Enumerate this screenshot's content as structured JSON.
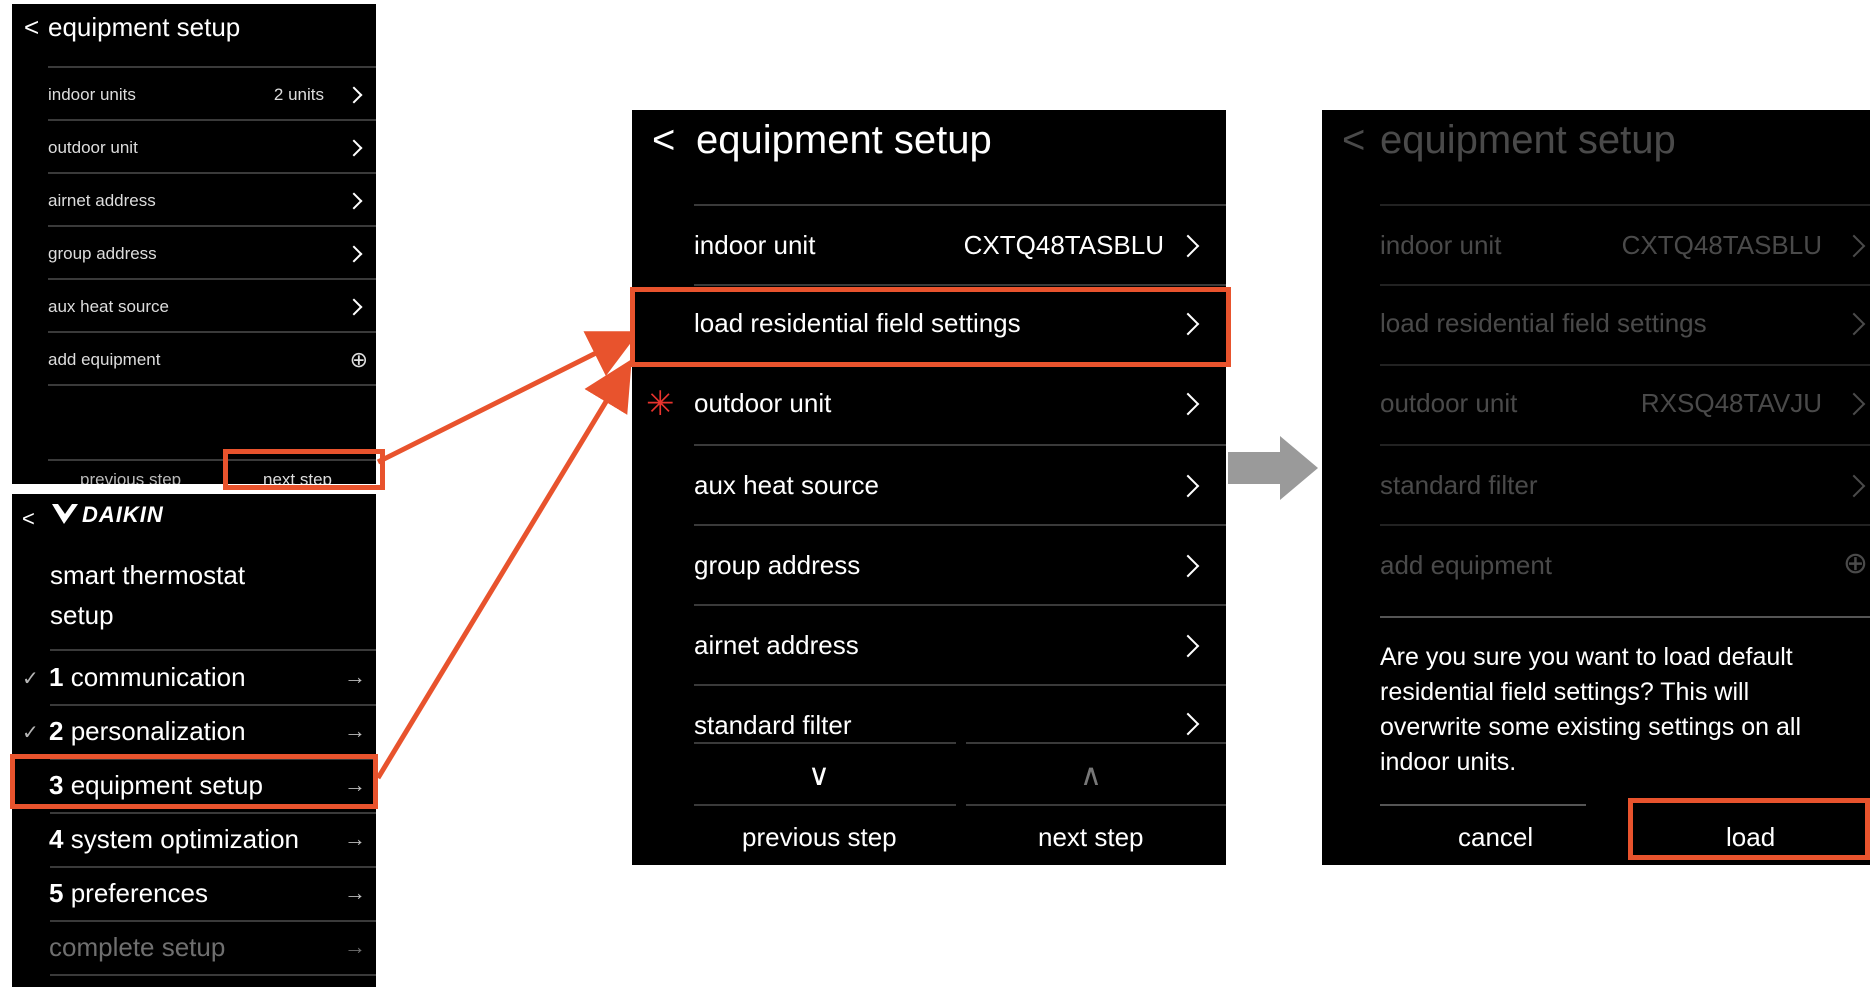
{
  "panel_a": {
    "title": "equipment setup",
    "back_glyph": "<",
    "items": [
      {
        "label": "indoor units",
        "value": "2 units"
      },
      {
        "label": "outdoor unit",
        "value": ""
      },
      {
        "label": "airnet address",
        "value": ""
      },
      {
        "label": "group address",
        "value": ""
      },
      {
        "label": "aux heat source",
        "value": ""
      },
      {
        "label": "add equipment",
        "value": ""
      }
    ],
    "add_glyph": "⊕",
    "previous_step": "previous step",
    "next_step": "next step"
  },
  "panel_b": {
    "brand": "DAIKIN",
    "back_glyph": "<",
    "title_line1": "smart thermostat",
    "title_line2": "setup",
    "steps": [
      {
        "num": "1",
        "label": "communication"
      },
      {
        "num": "2",
        "label": "personalization"
      },
      {
        "num": "3",
        "label": "equipment setup"
      },
      {
        "num": "4",
        "label": "system optimization"
      },
      {
        "num": "5",
        "label": "preferences"
      }
    ],
    "complete": "complete setup",
    "check_glyph": "✓",
    "arrow_glyph": "→"
  },
  "panel_c": {
    "title": "equipment setup",
    "back_glyph": "<",
    "items": [
      {
        "label": "indoor unit",
        "value": "CXTQ48TASBLU"
      },
      {
        "label": "load residential field settings",
        "value": ""
      },
      {
        "label": "outdoor unit",
        "value": ""
      },
      {
        "label": "aux heat source",
        "value": ""
      },
      {
        "label": "group address",
        "value": ""
      },
      {
        "label": "airnet address",
        "value": ""
      },
      {
        "label": "standard filter",
        "value": ""
      }
    ],
    "required_glyph": "✳",
    "down_glyph": "∨",
    "up_glyph": "∧",
    "previous_step": "previous step",
    "next_step": "next step"
  },
  "panel_d": {
    "title": "equipment setup",
    "back_glyph": "<",
    "items": [
      {
        "label": "indoor unit",
        "value": "CXTQ48TASBLU"
      },
      {
        "label": "load residential field settings",
        "value": ""
      },
      {
        "label": "outdoor unit",
        "value": "RXSQ48TAVJU"
      },
      {
        "label": "standard filter",
        "value": ""
      },
      {
        "label": "add equipment",
        "value": ""
      }
    ],
    "add_glyph": "⊕",
    "dialog_message": "Are you sure you want to load default residential field settings? This will overwrite some existing settings on all indoor units.",
    "cancel": "cancel",
    "load": "load"
  },
  "colors": {
    "highlight": "#e8532d",
    "required_star": "#e8332d",
    "panel_bg": "#000000",
    "dim_text": "#4a4a4a",
    "flow_arrow": "#9a9a9a"
  }
}
